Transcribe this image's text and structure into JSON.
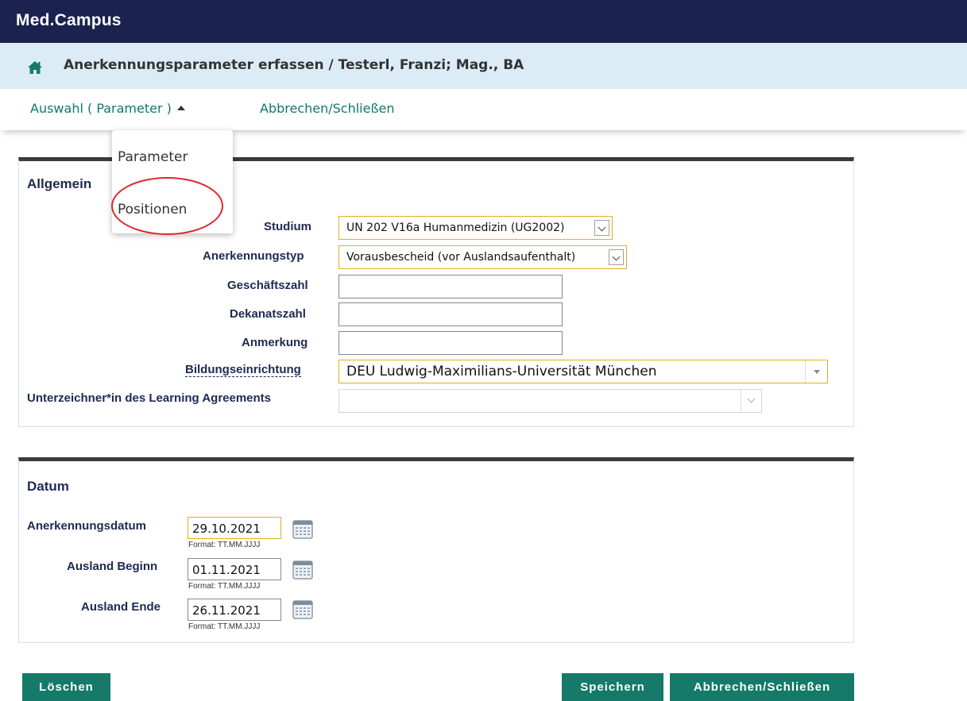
{
  "app": {
    "title": "Med.Campus"
  },
  "breadcrumb": {
    "title": "Anerkennungsparameter erfassen  / Testerl, Franzi; Mag., BA"
  },
  "menu": {
    "selection_label": "Auswahl ( Parameter )",
    "cancel_label": "Abbrechen/Schließen",
    "dropdown_items": [
      "Parameter",
      "Positionen"
    ]
  },
  "allgemein": {
    "title": "Allgemein",
    "fields": {
      "studium": {
        "label": "Studium",
        "value": "UN 202 V16a Humanmedizin (UG2002)"
      },
      "anerkennungstyp": {
        "label": "Anerkennungstyp",
        "value": "Vorausbescheid (vor Auslandsaufenthalt)"
      },
      "geschaeftszahl": {
        "label": "Geschäftszahl",
        "value": ""
      },
      "dekanatszahl": {
        "label": "Dekanatszahl",
        "value": ""
      },
      "anmerkung": {
        "label": "Anmerkung",
        "value": ""
      },
      "bildungseinrichtung": {
        "label": "Bildungseinrichtung",
        "value": "DEU Ludwig-Maximilians-Universität München"
      },
      "unterzeichner": {
        "label": "Unterzeichner*in des Learning Agreements",
        "value": ""
      }
    }
  },
  "datum": {
    "title": "Datum",
    "format_hint": "Format: TT.MM.JJJJ",
    "fields": {
      "anerkennungsdatum": {
        "label": "Anerkennungsdatum",
        "value": "29.10.2021"
      },
      "ausland_beginn": {
        "label": "Ausland Beginn",
        "value": "01.11.2021"
      },
      "ausland_ende": {
        "label": "Ausland Ende",
        "value": "26.11.2021"
      }
    }
  },
  "buttons": {
    "delete": "Löschen",
    "save": "Speichern",
    "cancel_close": "Abbrechen/Schließen"
  },
  "colors": {
    "topbar": "#1b2250",
    "breadcrumb_bg": "#dcecf7",
    "accent": "#157a69",
    "link": "#0f7a6b",
    "highlight_border": "#e0b020",
    "annotation": "#e0242a"
  },
  "icons": [
    "home-icon",
    "caret-up-icon",
    "chevron-down-icon",
    "calendar-icon"
  ]
}
